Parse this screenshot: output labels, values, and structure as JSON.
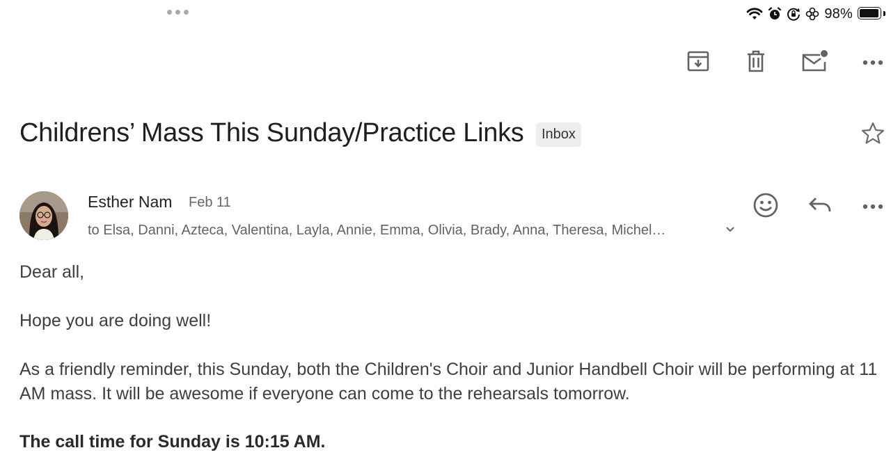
{
  "status_bar": {
    "battery_percent": "98%",
    "icons": [
      "wifi-icon",
      "alarm-icon",
      "rotation-lock-icon",
      "focus-icon",
      "battery-icon"
    ]
  },
  "toolbar": {
    "actions": [
      "archive-icon",
      "trash-icon",
      "mark-unread-icon",
      "more-icon"
    ]
  },
  "email": {
    "subject": "Childrens’ Mass This Sunday/Practice Links",
    "label": "Inbox",
    "sender": "Esther Nam",
    "date": "Feb 11",
    "recipients": "to Elsa, Danni, Azteca, Valentina, Layla, Annie, Emma, Olivia, Brady, Anna, Theresa, Michel…",
    "body": {
      "greeting": "Dear all,",
      "line1": "Hope you are doing well!",
      "line2": "As a friendly reminder, this Sunday, both the Children's Choir and Junior Handbell Choir will be performing at 11 AM mass. It will be awesome if everyone can come to the rehearsals tomorrow.",
      "line3": "The call time for Sunday is 10:15 AM."
    }
  },
  "colors": {
    "icon": "#5f6368",
    "chip_bg": "#eeeeee",
    "text": "#3c4043"
  }
}
